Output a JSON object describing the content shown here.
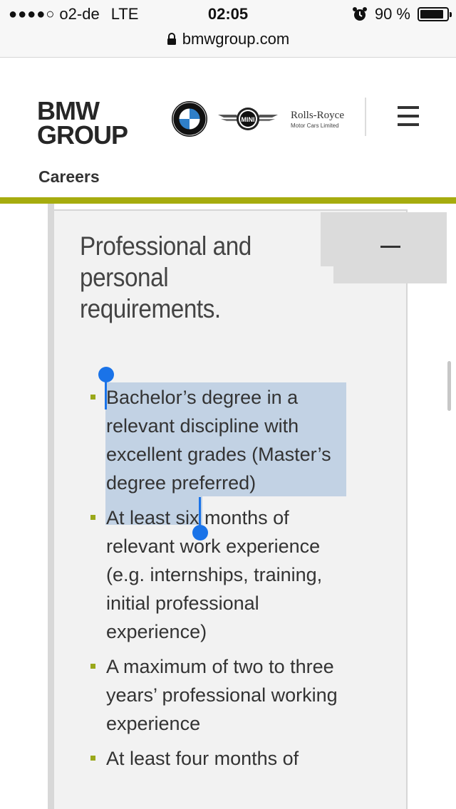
{
  "status_bar": {
    "signal_dots": "●●●●○",
    "carrier": "o2-de",
    "network": "LTE",
    "time": "02:05",
    "battery_percent": "90 %",
    "battery_level": 0.9,
    "alarm_icon": "alarm-clock-icon"
  },
  "browser": {
    "url": "bmwgroup.com",
    "lock_icon": "lock-icon"
  },
  "header": {
    "logo_line1": "BMW",
    "logo_line2": "GROUP",
    "brand_rolls_royce": "Rolls-Royce",
    "brand_rolls_royce_sub": "Motor Cars Limited",
    "brand_mini": "MINI",
    "section_label": "Careers",
    "accent_color": "#a6ac0e"
  },
  "accordion": {
    "title": "Professional and personal requirements.",
    "toggle_icon": "minus-icon",
    "items": [
      "Bachelor’s degree in a relevant discipline with excellent grades (Master’s degree preferred)",
      "At least six months of relevant work experience (e.g. internships, training, initial professional experience)",
      "A maximum of two to three years’ professional working experience",
      "At least four months of"
    ],
    "bullet_color": "#9aa81a"
  }
}
